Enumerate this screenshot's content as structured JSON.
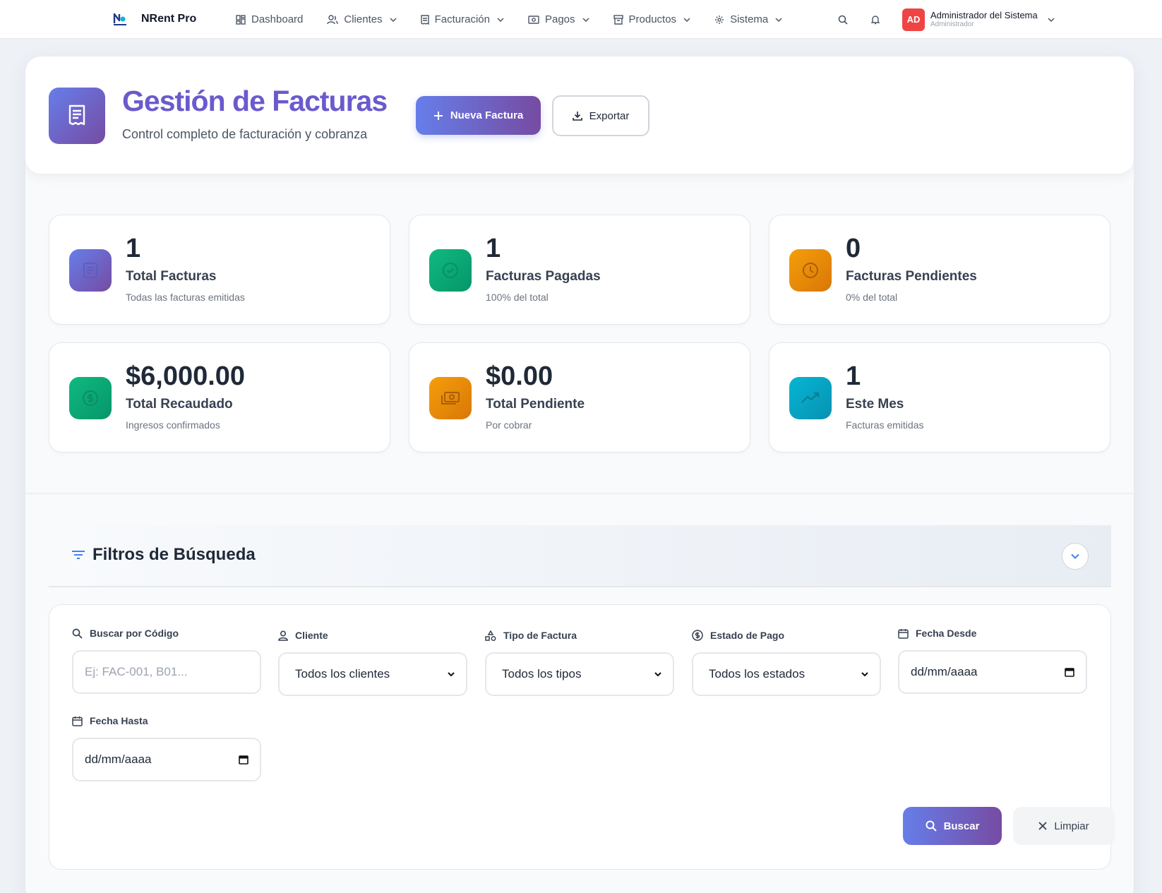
{
  "navbar": {
    "brand_name": "NRent Pro",
    "items": [
      {
        "label": "Dashboard",
        "icon": "grid-icon",
        "dropdown": false
      },
      {
        "label": "Clientes",
        "icon": "users-icon",
        "dropdown": true
      },
      {
        "label": "Facturación",
        "icon": "receipt-icon",
        "dropdown": true
      },
      {
        "label": "Pagos",
        "icon": "cash-icon",
        "dropdown": true
      },
      {
        "label": "Productos",
        "icon": "box-icon",
        "dropdown": true
      },
      {
        "label": "Sistema",
        "icon": "gear-icon",
        "dropdown": true
      }
    ],
    "user": {
      "initials": "AD",
      "name": "Administrador del Sistema",
      "role": "Administrador"
    }
  },
  "header": {
    "title": "Gestión de Facturas",
    "subtitle": "Control completo de facturación y cobranza",
    "new_button": "Nueva Factura",
    "export_button": "Exportar"
  },
  "stats": [
    {
      "value": "1",
      "label": "Total Facturas",
      "desc": "Todas las facturas emitidas",
      "icon": "document-icon",
      "color_from": "#667eea",
      "color_to": "#764ba2"
    },
    {
      "value": "1",
      "label": "Facturas Pagadas",
      "desc": "100% del total",
      "icon": "check-circle-icon",
      "color_from": "#10b981",
      "color_to": "#059669"
    },
    {
      "value": "0",
      "label": "Facturas Pendientes",
      "desc": "0% del total",
      "icon": "clock-icon",
      "color_from": "#f59e0b",
      "color_to": "#d97706"
    },
    {
      "value": "$6,000.00",
      "label": "Total Recaudado",
      "desc": "Ingresos confirmados",
      "icon": "dollar-circle-icon",
      "color_from": "#10b981",
      "color_to": "#059669"
    },
    {
      "value": "$0.00",
      "label": "Total Pendiente",
      "desc": "Por cobrar",
      "icon": "cash-icon",
      "color_from": "#f59e0b",
      "color_to": "#d97706"
    },
    {
      "value": "1",
      "label": "Este Mes",
      "desc": "Facturas emitidas",
      "icon": "trending-up-icon",
      "color_from": "#06b6d4",
      "color_to": "#0891b2"
    }
  ],
  "filters": {
    "title": "Filtros de Búsqueda",
    "code": {
      "label": "Buscar por Código",
      "placeholder": "Ej: FAC-001, B01..."
    },
    "client": {
      "label": "Cliente",
      "value": "Todos los clientes"
    },
    "type": {
      "label": "Tipo de Factura",
      "value": "Todos los tipos"
    },
    "status": {
      "label": "Estado de Pago",
      "value": "Todos los estados"
    },
    "date_from": {
      "label": "Fecha Desde",
      "value": "dd/mm/aaaa"
    },
    "date_to": {
      "label": "Fecha Hasta",
      "value": "dd/mm/aaaa"
    },
    "search_button": "Buscar",
    "clear_button": "Limpiar"
  },
  "colors": {
    "accent_from": "#667eea",
    "accent_to": "#764ba2",
    "avatar": "#ef4444"
  }
}
